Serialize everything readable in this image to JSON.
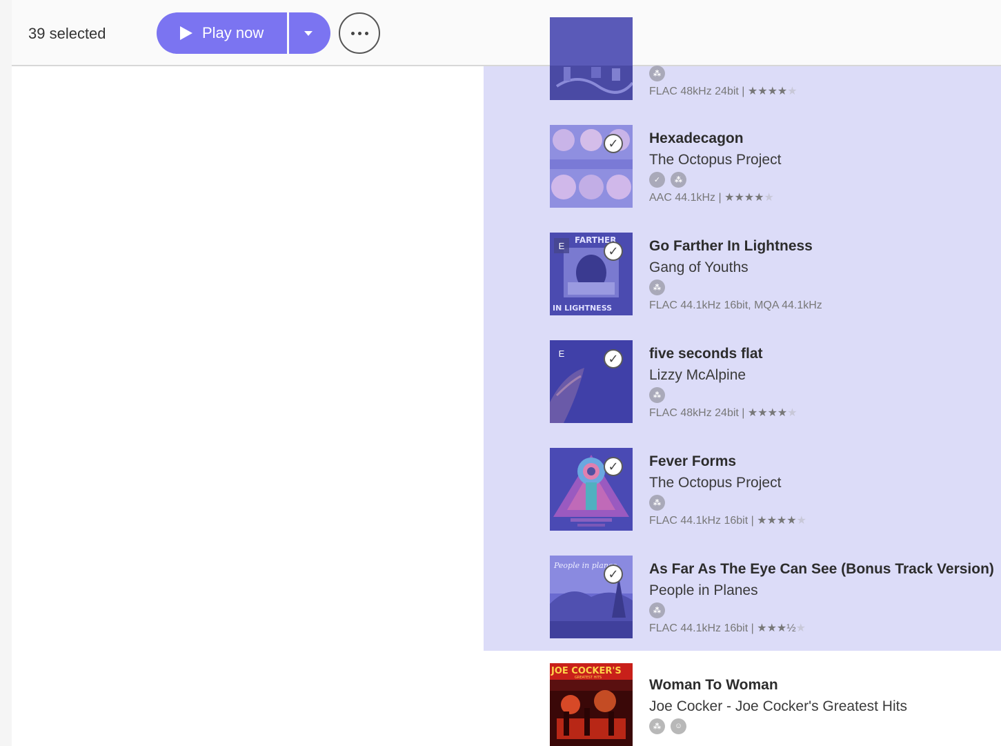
{
  "toolbar": {
    "selected_text": "39 selected",
    "play_label": "Play now",
    "dropdown_icon": "chevron-down-icon",
    "more_icon": "more-dots-icon"
  },
  "colors": {
    "accent": "#7b74f1",
    "selection_bg": "#dcdcf8"
  },
  "albums": [
    {
      "title": "",
      "artist": "",
      "sources": [
        "tidal-icon"
      ],
      "format": "FLAC 48kHz 24bit |",
      "rating": 4,
      "selected": false,
      "explicit": false
    },
    {
      "title": "Hexadecagon",
      "artist": "The Octopus Project",
      "sources": [
        "check-icon",
        "tidal-icon"
      ],
      "format": "AAC 44.1kHz |",
      "rating": 4.5,
      "selected": true,
      "explicit": false
    },
    {
      "title": "Go Farther In Lightness",
      "artist": "Gang of Youths",
      "sources": [
        "tidal-icon"
      ],
      "format": "FLAC 44.1kHz 16bit, MQA 44.1kHz",
      "rating": null,
      "selected": true,
      "explicit": true,
      "cover_text_top": "FARTHER",
      "cover_text_bottom": "IN LIGHTNESS"
    },
    {
      "title": "five seconds flat",
      "artist": "Lizzy McAlpine",
      "sources": [
        "tidal-icon"
      ],
      "format": "FLAC 48kHz 24bit |",
      "rating": 4,
      "selected": true,
      "explicit": true
    },
    {
      "title": "Fever Forms",
      "artist": "The Octopus Project",
      "sources": [
        "tidal-icon"
      ],
      "format": "FLAC 44.1kHz 16bit |",
      "rating": 4,
      "selected": true,
      "explicit": false
    },
    {
      "title": "As Far As The Eye Can See (Bonus Track Version)",
      "artist": "People in Planes",
      "sources": [
        "tidal-icon"
      ],
      "format": "FLAC 44.1kHz 16bit |",
      "rating": 3.5,
      "selected": true,
      "explicit": false,
      "cover_text": "People in planes"
    },
    {
      "title": "Woman To Woman",
      "artist": "Joe Cocker - Joe Cocker's Greatest Hits",
      "sources": [
        "tidal-icon",
        "people-icon"
      ],
      "format": "",
      "rating": null,
      "selected": false,
      "explicit": false,
      "cover_text": "JOE COCKER'S",
      "cover_subtext": "GREATEST HITS"
    }
  ]
}
